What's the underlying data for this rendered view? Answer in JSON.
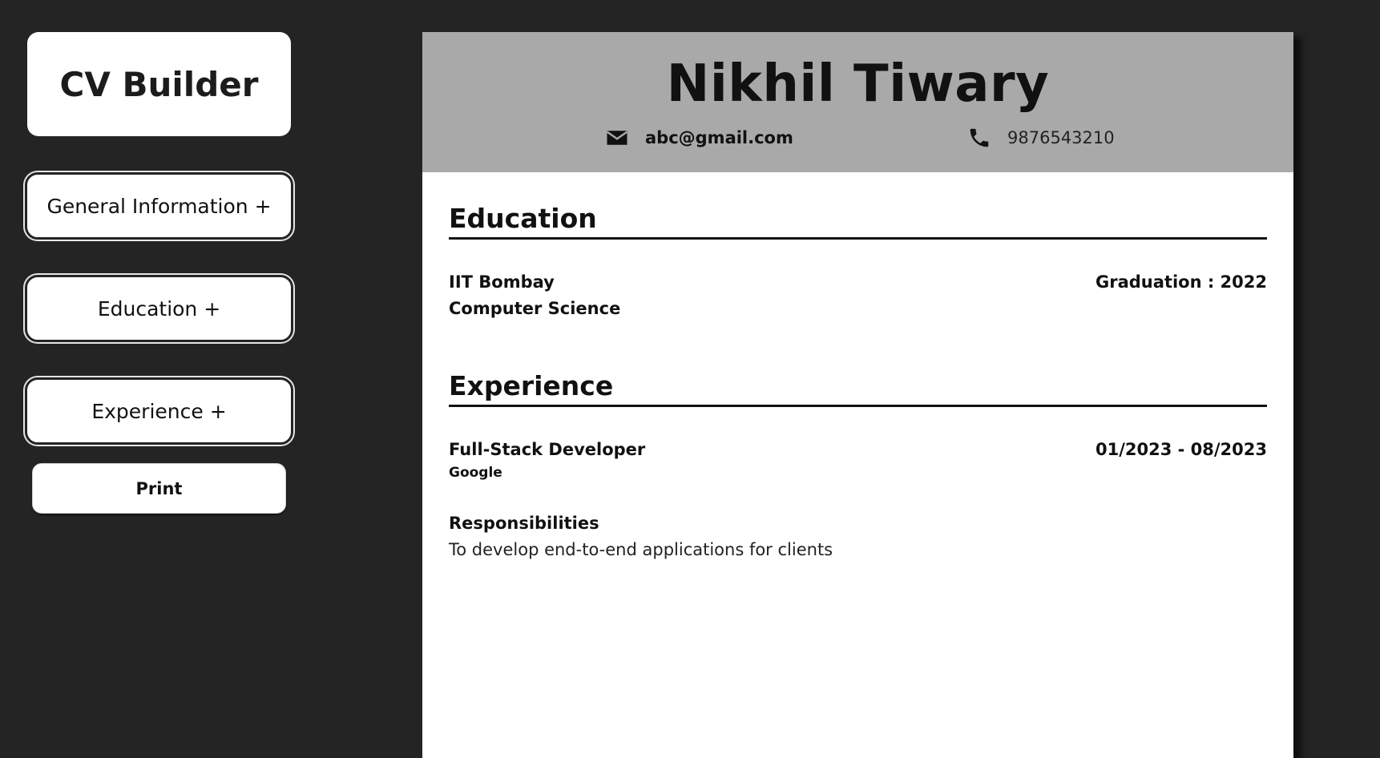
{
  "app": {
    "title": "CV Builder"
  },
  "sidebar": {
    "buttons": [
      {
        "label": "General Information +"
      },
      {
        "label": "Education +"
      },
      {
        "label": "Experience +"
      }
    ],
    "print_label": "Print"
  },
  "cv": {
    "name": "Nikhil Tiwary",
    "email": "abc@gmail.com",
    "phone": "9876543210",
    "education": {
      "heading": "Education",
      "entries": [
        {
          "school": "IIT Bombay",
          "degree": "Computer Science",
          "graduation": "Graduation : 2022"
        }
      ]
    },
    "experience": {
      "heading": "Experience",
      "entries": [
        {
          "role": "Full-Stack Developer",
          "company": "Google",
          "dates": "01/2023 - 08/2023",
          "responsibilities_label": "Responsibilities",
          "responsibilities": "To develop end-to-end applications for clients"
        }
      ]
    }
  },
  "colors": {
    "background": "#242424",
    "header_band": "#a9a9a9",
    "card": "#ffffff",
    "text": "#111111"
  },
  "icons": {
    "email": "mail-icon",
    "phone": "phone-icon"
  }
}
